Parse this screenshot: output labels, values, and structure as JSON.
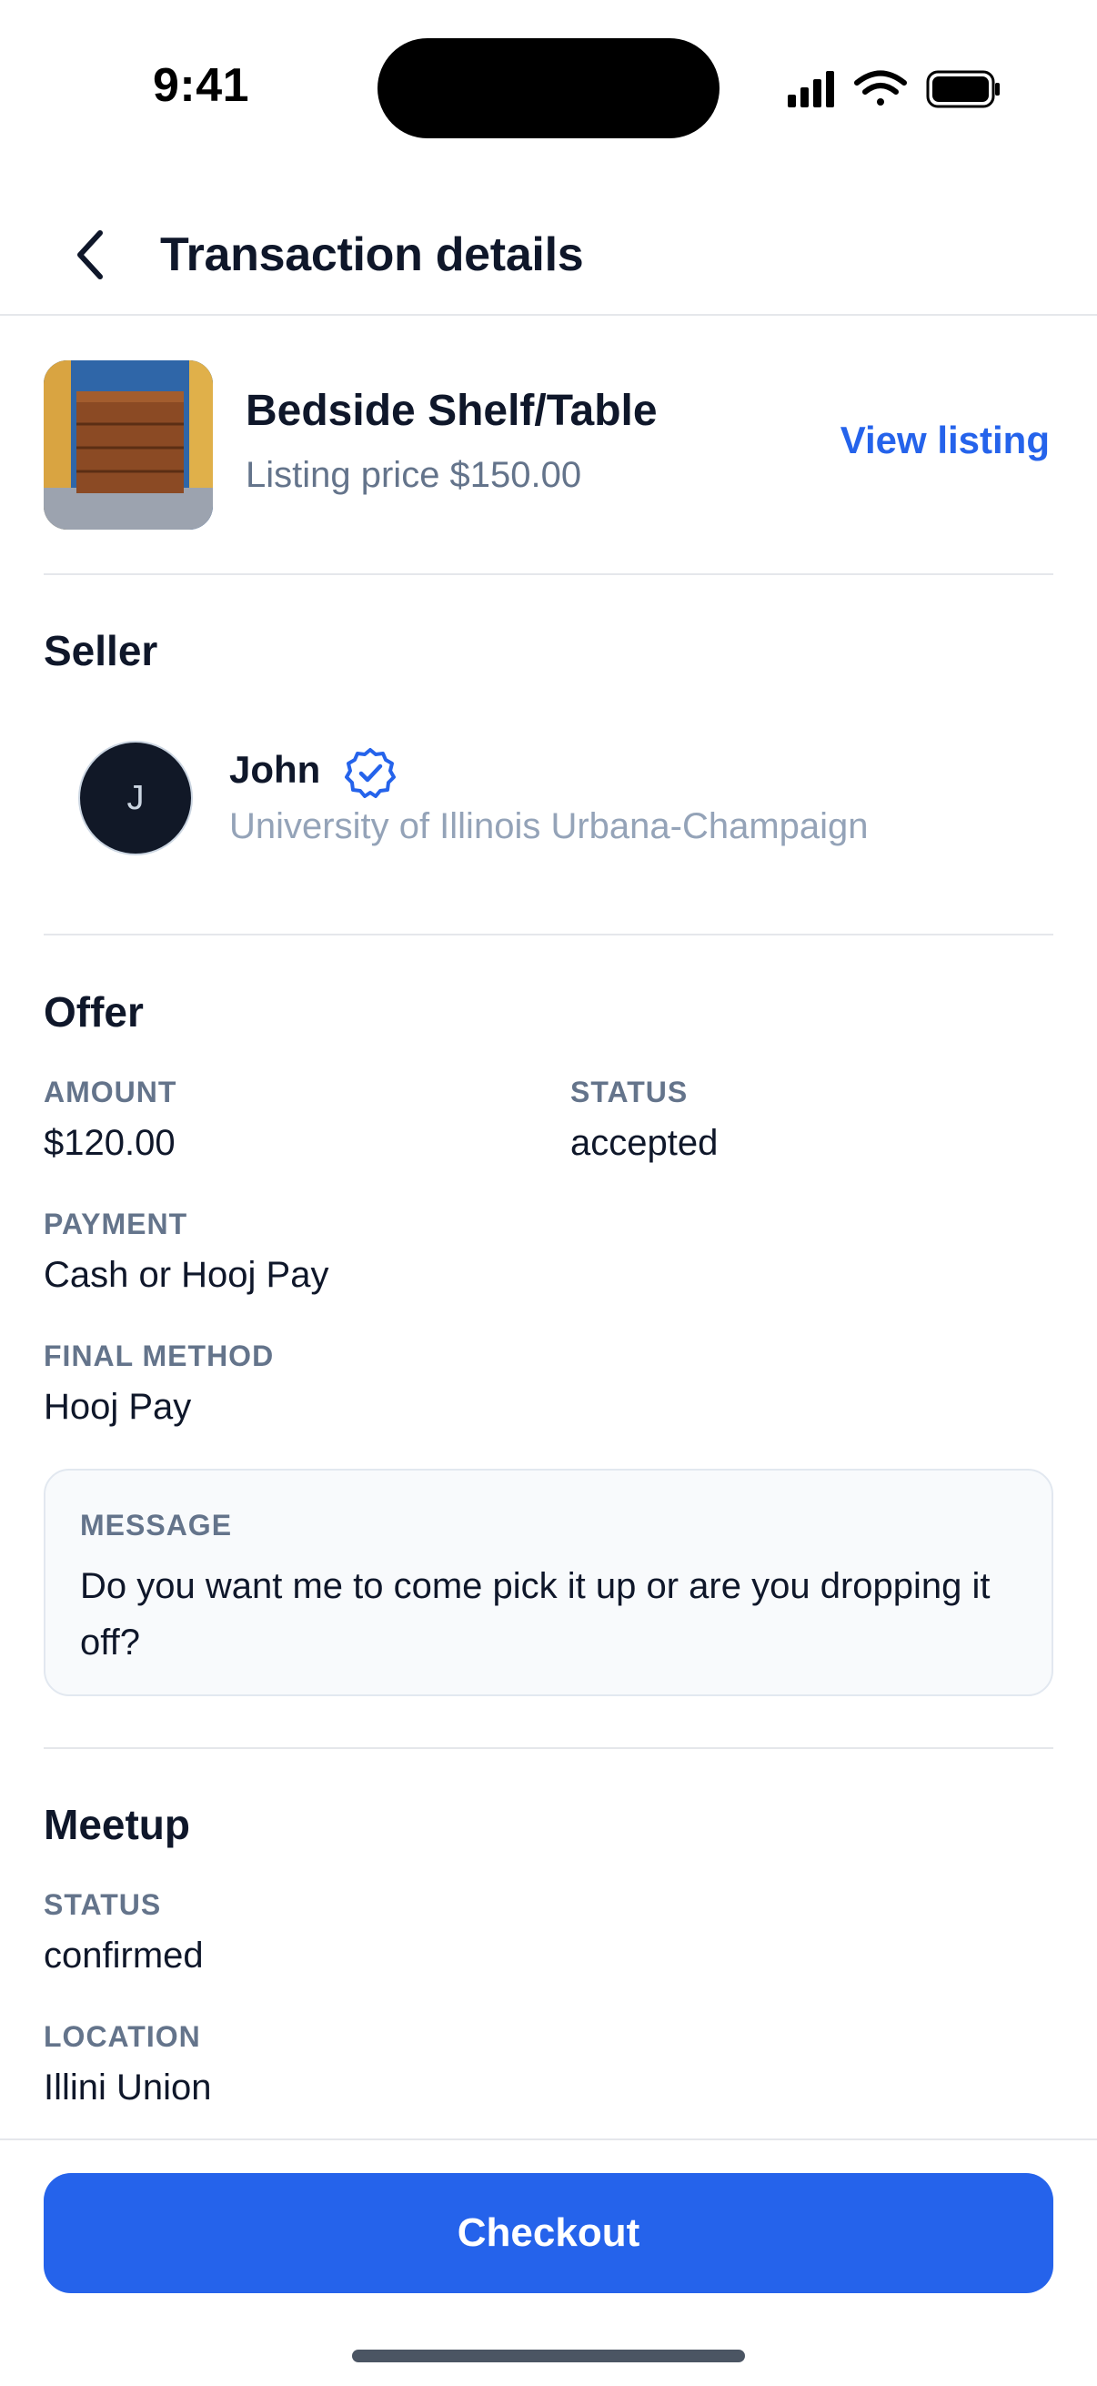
{
  "status_bar": {
    "time": "9:41",
    "icons": [
      "cellular-signal-icon",
      "wifi-icon",
      "battery-icon"
    ]
  },
  "header": {
    "back_icon": "chevron-left-icon",
    "title": "Transaction details"
  },
  "listing": {
    "title": "Bedside Shelf/Table",
    "price": "Listing price $150.00",
    "view_link": "View listing"
  },
  "seller": {
    "section_title": "Seller",
    "avatar_initial": "J",
    "name": "John",
    "verified_icon": "verified-badge-icon",
    "school": "University of Illinois Urbana-Champaign"
  },
  "offer": {
    "section_title": "Offer",
    "amount_label": "AMOUNT",
    "amount_value": "$120.00",
    "status_label": "STATUS",
    "status_value": "accepted",
    "payment_label": "PAYMENT",
    "payment_value": "Cash or Hooj Pay",
    "final_method_label": "FINAL METHOD",
    "final_method_value": "Hooj Pay",
    "message_label": "MESSAGE",
    "message_text": "Do you want me to come pick it up or are you dropping it off?"
  },
  "meetup": {
    "section_title": "Meetup",
    "status_label": "STATUS",
    "status_value": "confirmed",
    "location_label": "LOCATION",
    "location_value": "Illini Union"
  },
  "footer": {
    "checkout_label": "Checkout"
  },
  "colors": {
    "accent": "#2563eb",
    "text": "#0f172a",
    "muted": "#64748b",
    "divider": "#e5e7eb"
  }
}
